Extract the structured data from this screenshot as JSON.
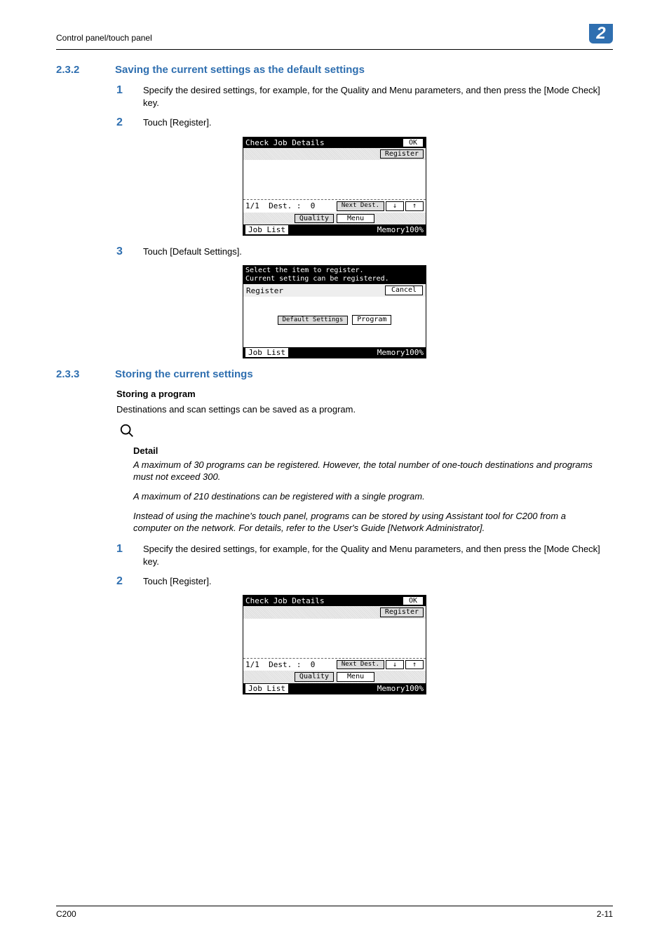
{
  "header": {
    "breadcrumb": "Control panel/touch panel",
    "chapter": "2"
  },
  "section_232": {
    "num": "2.3.2",
    "title": "Saving the current settings as the default settings"
  },
  "section_233": {
    "num": "2.3.3",
    "title": "Storing the current settings"
  },
  "steps_232": {
    "s1": {
      "n": "1",
      "text": "Specify the desired settings, for example, for the Quality and Menu parameters, and then press the [Mode Check] key."
    },
    "s2": {
      "n": "2",
      "text": "Touch [Register]."
    },
    "s3": {
      "n": "3",
      "text": "Touch [Default Settings]."
    }
  },
  "storing_sub": "Storing a program",
  "storing_para": "Destinations and scan settings can be saved as a program.",
  "detail": {
    "head": "Detail",
    "p1": "A maximum of 30 programs can be registered. However, the total number of one-touch destinations and programs must not exceed 300.",
    "p2": "A maximum of 210 destinations can be registered with a single program.",
    "p3": "Instead of using the machine's touch panel, programs can be stored by using Assistant tool for C200 from a computer on the network. For details, refer to the User's Guide [Network Administrator]."
  },
  "steps_233": {
    "s1": {
      "n": "1",
      "text": "Specify the desired settings, for example, for the Quality and Menu parameters, and then press the [Mode Check] key."
    },
    "s2": {
      "n": "2",
      "text": "Touch [Register]."
    }
  },
  "lcd_check": {
    "title": "Check Job Details",
    "ok": "OK",
    "register": "Register",
    "dest": "Dest. :",
    "page": "1/1",
    "dest_n": "0",
    "next": "Next Dest.",
    "down": "↓",
    "up": "↑",
    "quality": "Quality",
    "menu": "Menu",
    "joblist": "Job List",
    "memory": "Memory100%"
  },
  "lcd_register": {
    "msg1": "Select the item to register.",
    "msg2": "Current setting can be registered.",
    "register": "Register",
    "cancel": "Cancel",
    "default": "Default Settings",
    "program": "Program",
    "joblist": "Job List",
    "memory": "Memory100%"
  },
  "footer": {
    "left": "C200",
    "right": "2-11"
  }
}
